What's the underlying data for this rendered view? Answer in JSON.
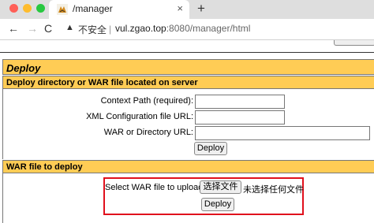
{
  "browser": {
    "tab_title": "/manager",
    "tab_close": "×",
    "new_tab": "+",
    "back": "←",
    "forward": "→",
    "reload": "C",
    "security_warning_icon": "▲",
    "security_text": "不安全",
    "separator": "|",
    "url_host": "vul.zgao.top",
    "url_rest": ":8080/manager/html"
  },
  "deploy": {
    "title": "Deploy",
    "server_section": "Deploy directory or WAR file located on server",
    "context_path_label": "Context Path (required):",
    "context_path_value": "",
    "xml_config_label": "XML Configuration file URL:",
    "xml_config_value": "",
    "war_dir_label": "WAR or Directory URL:",
    "war_dir_value": "",
    "deploy_button": "Deploy"
  },
  "war_upload": {
    "section": "WAR file to deploy",
    "label": "Select WAR file to upload",
    "choose_button": "选择文件",
    "no_file_text": "未选择任何文件",
    "deploy_button": "Deploy"
  }
}
